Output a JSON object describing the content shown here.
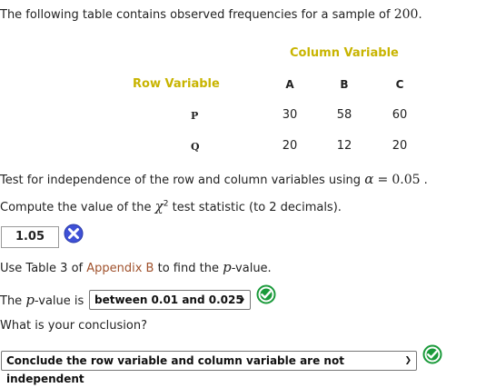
{
  "intro": {
    "text": "The following table contains observed frequencies for a sample of ",
    "sample_size": "200",
    "period": "."
  },
  "table": {
    "column_variable_label": "Column Variable",
    "row_variable_label": "Row Variable",
    "columns": [
      "A",
      "B",
      "C"
    ],
    "rows": [
      {
        "label": "P",
        "values": [
          "30",
          "58",
          "60"
        ]
      },
      {
        "label": "Q",
        "values": [
          "20",
          "12",
          "20"
        ]
      }
    ]
  },
  "test_line": {
    "text": "Test for independence of the row and column variables using ",
    "alpha_symbol": "α",
    "equals": "=",
    "alpha_value": "0.05",
    "period": "."
  },
  "compute_line": {
    "before": "Compute the value of the ",
    "chi": "χ",
    "sup": "2",
    "after": " test statistic (to 2 decimals)."
  },
  "answer": {
    "value": "1.05",
    "status_icon": "incorrect-x-icon",
    "status_color": "#3f51d6"
  },
  "table3_line": {
    "before": "Use Table 3 of ",
    "link": "Appendix B",
    "middle": " to find the ",
    "p": "p",
    "after": "-value."
  },
  "pvalue_line": {
    "before": "The ",
    "p": "p",
    "after": "-value is",
    "selected": "between 0.01 and 0.025",
    "status_icon": "correct-check-icon",
    "status_color": "#1a9a3a"
  },
  "conclusion": {
    "question": "What is your conclusion?",
    "selected": "Conclude the row variable and column variable are not independent",
    "status_icon": "correct-check-icon"
  }
}
